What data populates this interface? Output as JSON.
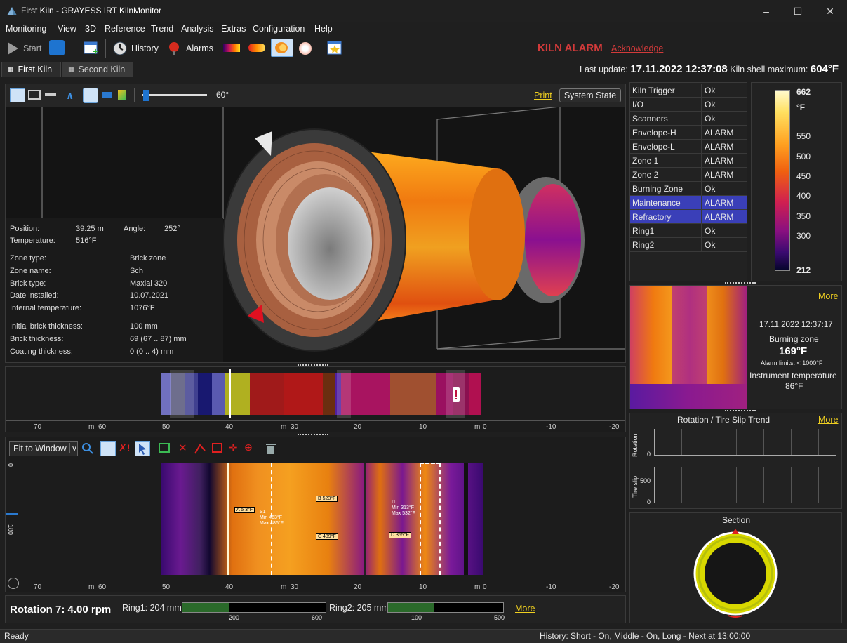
{
  "window": {
    "title": "First Kiln - GRAYESS IRT KilnMonitor"
  },
  "menu": [
    "Monitoring",
    "View",
    "3D",
    "Reference",
    "Trend",
    "Analysis",
    "Extras",
    "Configuration",
    "Help"
  ],
  "toolbar": {
    "start": "Start",
    "history": "History",
    "alarms": "Alarms"
  },
  "alarm": {
    "text": "KILN ALARM",
    "ack": "Acknowledge",
    "color": "#d23a3a"
  },
  "tabs": [
    "First Kiln",
    "Second Kiln"
  ],
  "header": {
    "last_update_label": "Last update:",
    "last_update": "17.11.2022 12:37:08",
    "shell_max_label": "Kiln shell maximum:",
    "shell_max": "604°F"
  },
  "view3d": {
    "angle_value": "60°",
    "print": "Print",
    "system_state": "System State"
  },
  "info": {
    "rows": [
      {
        "k": "Position:",
        "v": "39.25 m",
        "k2": "Angle:",
        "v2": "252°"
      },
      {
        "k": "Temperature:",
        "v": "516°F"
      }
    ],
    "zone": [
      {
        "k": "Zone type:",
        "v": "Brick zone"
      },
      {
        "k": "Zone name:",
        "v": "Sch"
      },
      {
        "k": "Brick type:",
        "v": "Maxial 320"
      },
      {
        "k": "Date installed:",
        "v": "10.07.2021"
      },
      {
        "k": "Internal temperature:",
        "v": "1076°F"
      }
    ],
    "thick": [
      {
        "k": "Initial brick thickness:",
        "v": "100 mm"
      },
      {
        "k": "Brick thickness:",
        "v": "69 (67 .. 87) mm"
      },
      {
        "k": "Coating thickness:",
        "v": "0 (0 .. 4) mm"
      }
    ]
  },
  "status_table": [
    {
      "k": "Kiln Trigger",
      "v": "Ok",
      "hl": false
    },
    {
      "k": "I/O",
      "v": "Ok",
      "hl": false
    },
    {
      "k": "Scanners",
      "v": "Ok",
      "hl": false
    },
    {
      "k": "Envelope-H",
      "v": "ALARM",
      "hl": false
    },
    {
      "k": "Envelope-L",
      "v": "ALARM",
      "hl": false
    },
    {
      "k": "Zone 1",
      "v": "ALARM",
      "hl": false
    },
    {
      "k": "Zone 2",
      "v": "ALARM",
      "hl": false
    },
    {
      "k": "Burning Zone",
      "v": "Ok",
      "hl": false
    },
    {
      "k": "Maintenance",
      "v": "ALARM",
      "hl": true
    },
    {
      "k": "Refractory",
      "v": "ALARM",
      "hl": true
    },
    {
      "k": "Ring1",
      "v": "Ok",
      "hl": false
    },
    {
      "k": "Ring2",
      "v": "Ok",
      "hl": false
    }
  ],
  "colorbar": {
    "max": "662",
    "unit": "°F",
    "ticks": [
      "550",
      "500",
      "450",
      "400",
      "350",
      "300"
    ],
    "min": "212"
  },
  "camera": {
    "more": "More",
    "datetime": "17.11.2022 12:37:17",
    "zone": "Burning zone",
    "temp": "169°F",
    "alarm_limits": "Alarm limits: < 1000°F",
    "instr_label": "Instrument temperature",
    "instr_temp": "86°F"
  },
  "trend": {
    "title": "Rotation / Tire Slip Trend",
    "more": "More",
    "rotation_label": "Rotation",
    "tireslip_label": "Tire slip",
    "rot_tick": "0",
    "slip_ticks": [
      "500",
      "0"
    ]
  },
  "section": {
    "title": "Section"
  },
  "ruler_labels": [
    "70",
    "m",
    "60",
    "50",
    "40",
    "m",
    "30",
    "20",
    "10",
    "m",
    "0",
    "-10",
    "-20"
  ],
  "bottom_toolbar": {
    "fit": "Fit to Window",
    "dropdown": "v"
  },
  "thermal": {
    "ylabel0": "0",
    "ylabel1": "180",
    "markers": [
      {
        "name": "A",
        "text": "A 5 3°F"
      },
      {
        "name": "B",
        "text": "B 523°F"
      },
      {
        "name": "C",
        "text": "C 489°F"
      },
      {
        "name": "D",
        "text": "D 365°F"
      }
    ],
    "s1": {
      "title": "S1",
      "min": "Min 463°F",
      "max": "Max 486°F"
    },
    "i1": {
      "title": "I1",
      "min": "Min 313°F",
      "max": "Max 532°F"
    }
  },
  "rotation": {
    "label": "Rotation 7: 4.00 rpm",
    "ring1": "Ring1: 204 mm",
    "ring1_min": "200",
    "ring1_max": "600",
    "ring2": "Ring2: 205 mm",
    "ring2_min": "100",
    "ring2_max": "500",
    "more": "More"
  },
  "statusbar": {
    "left": "Ready",
    "right": "History: Short - On, Middle - On, Long - Next at 13:00:00"
  }
}
